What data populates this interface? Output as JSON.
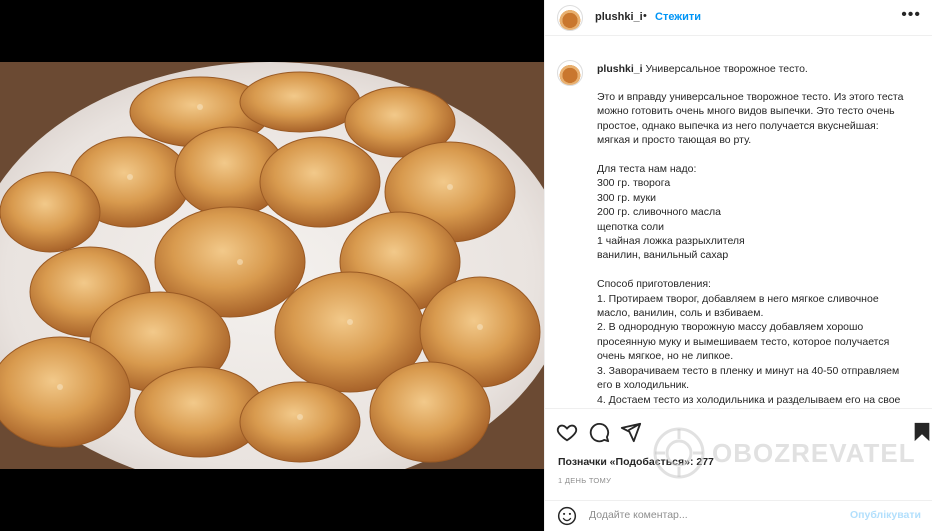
{
  "post": {
    "username": "plushki_i",
    "follow_label": "Стежити",
    "separator": "•",
    "more_label": "•••"
  },
  "caption": {
    "username": "plushki_i",
    "title": "Универсальное творожное тесто.",
    "paragraph1": [
      "Это и вправду универсальное творожное тесто. Из этого теста",
      "можно готовить очень много видов выпечки. Это тесто очень",
      "простое, однако выпечка из него получается вкуснейшая:",
      "мягкая и просто тающая во рту."
    ],
    "ingredients": [
      "Для теста нам надо:",
      "300 гр. творога",
      "300 гр. муки",
      "200 гр. сливочного масла",
      "щепотка соли",
      "1 чайная ложка разрыхлителя",
      "ванилин, ванильный сахар"
    ],
    "steps": [
      "Способ приготовления:",
      "1. Протираем творог, добавляем в него мягкое сливочное",
      "масло, ванилин, соль и взбиваем.",
      "2. В однородную творожную массу добавляем хорошо",
      "просеянную муку и вымешиваем тесто, которое получается",
      "очень мягкое, но не липкое.",
      "3. Заворачиваем тесто в пленку и минут на 40-50 отправляем",
      "его в холодильник.",
      "4. Достаем тесто из холодильника и разделываем его на свое"
    ]
  },
  "stats": {
    "likes_label": "Позначки «Подобається»: 277",
    "time_label": "1 ДЕНЬ ТОМУ"
  },
  "comment": {
    "placeholder": "Додайте коментар...",
    "post_label": "Опублікувати"
  },
  "watermark": {
    "text": "OBOZREVATEL"
  },
  "icons": {
    "heart": "heart-icon",
    "comment": "comment-icon",
    "share": "share-icon",
    "save": "bookmark-icon",
    "emoji": "emoji-icon",
    "more": "more-icon"
  },
  "colors": {
    "follow": "#0095f6",
    "post_disabled": "#b2dffc",
    "muted": "#8e8e8e",
    "text": "#262626"
  }
}
